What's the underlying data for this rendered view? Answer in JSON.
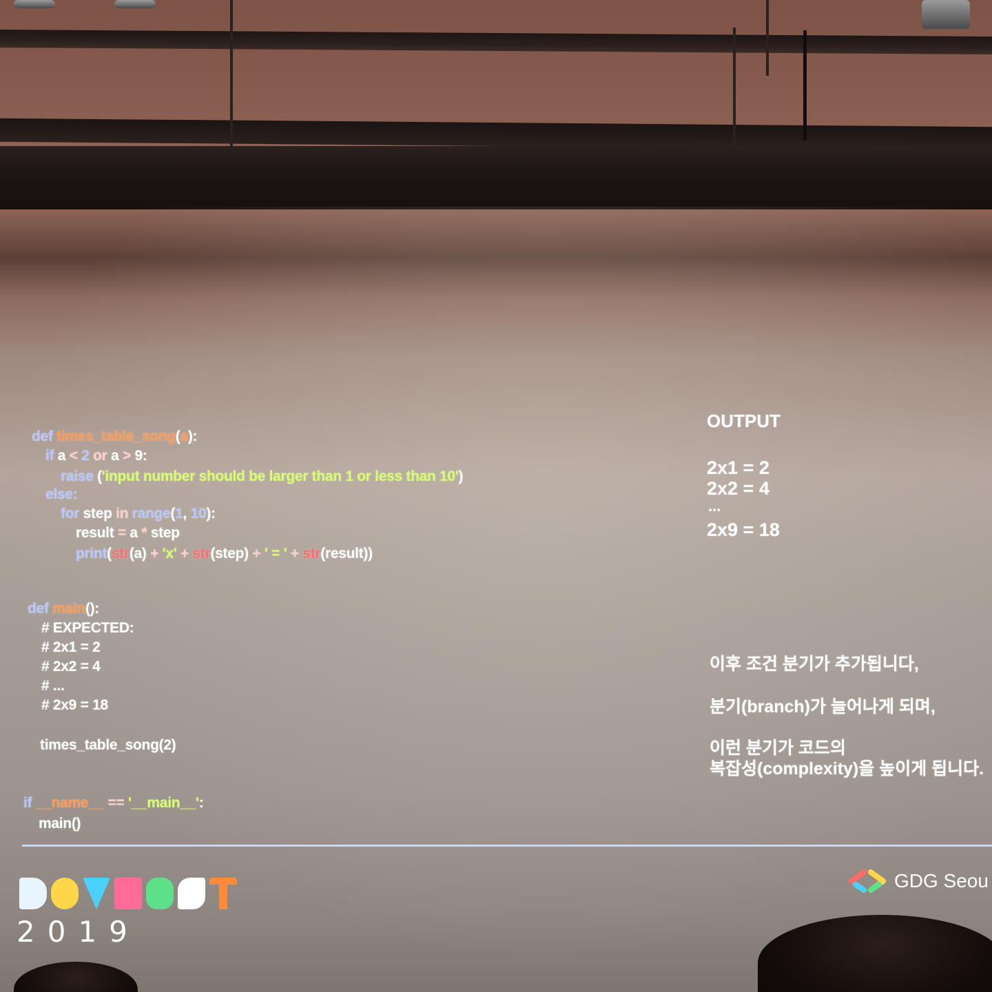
{
  "code": {
    "lines": [
      "def times_table_song(a):",
      "if a < 2 or a > 9:",
      "raise ('input number should be larger than 1 or less than 10')",
      "else:",
      "for step in range(1, 10):",
      "result = a * step",
      "print(str(a) + 'x' + str(step) + ' = ' + str(result))",
      "def main():",
      "# EXPECTED:",
      "# 2x1 = 2",
      "# 2x2 = 4",
      "# ...",
      "# 2x9 = 18",
      "times_table_song(2)",
      "if __name__ == '__main__':",
      "main()"
    ]
  },
  "output": {
    "heading": "OUTPUT",
    "lines": [
      "2x1 = 2",
      "2x2 = 4",
      "...",
      "2x9 = 18"
    ]
  },
  "notes": [
    "이후 조건 분기가 추가됩니다,",
    "분기(branch)가 늘어나게 되며,",
    "이런 분기가 코드의",
    "복잡성(complexity)을 높이게 됩니다."
  ],
  "branding": {
    "event_name": "DEVFEST",
    "event_year": "2019",
    "organizer": "GDG Seou"
  },
  "colors": {
    "keyword": "#b9c7ff",
    "function_name": "#ff9a55",
    "string": "#d8ff6a",
    "builtin": "#ff6a6a",
    "logo_blocks": [
      "#e8f5ff",
      "#ffd54a",
      "#4ad1ff",
      "#ff6b9a",
      "#5ee08a",
      "#ffffff",
      "#ff8a3a"
    ]
  }
}
